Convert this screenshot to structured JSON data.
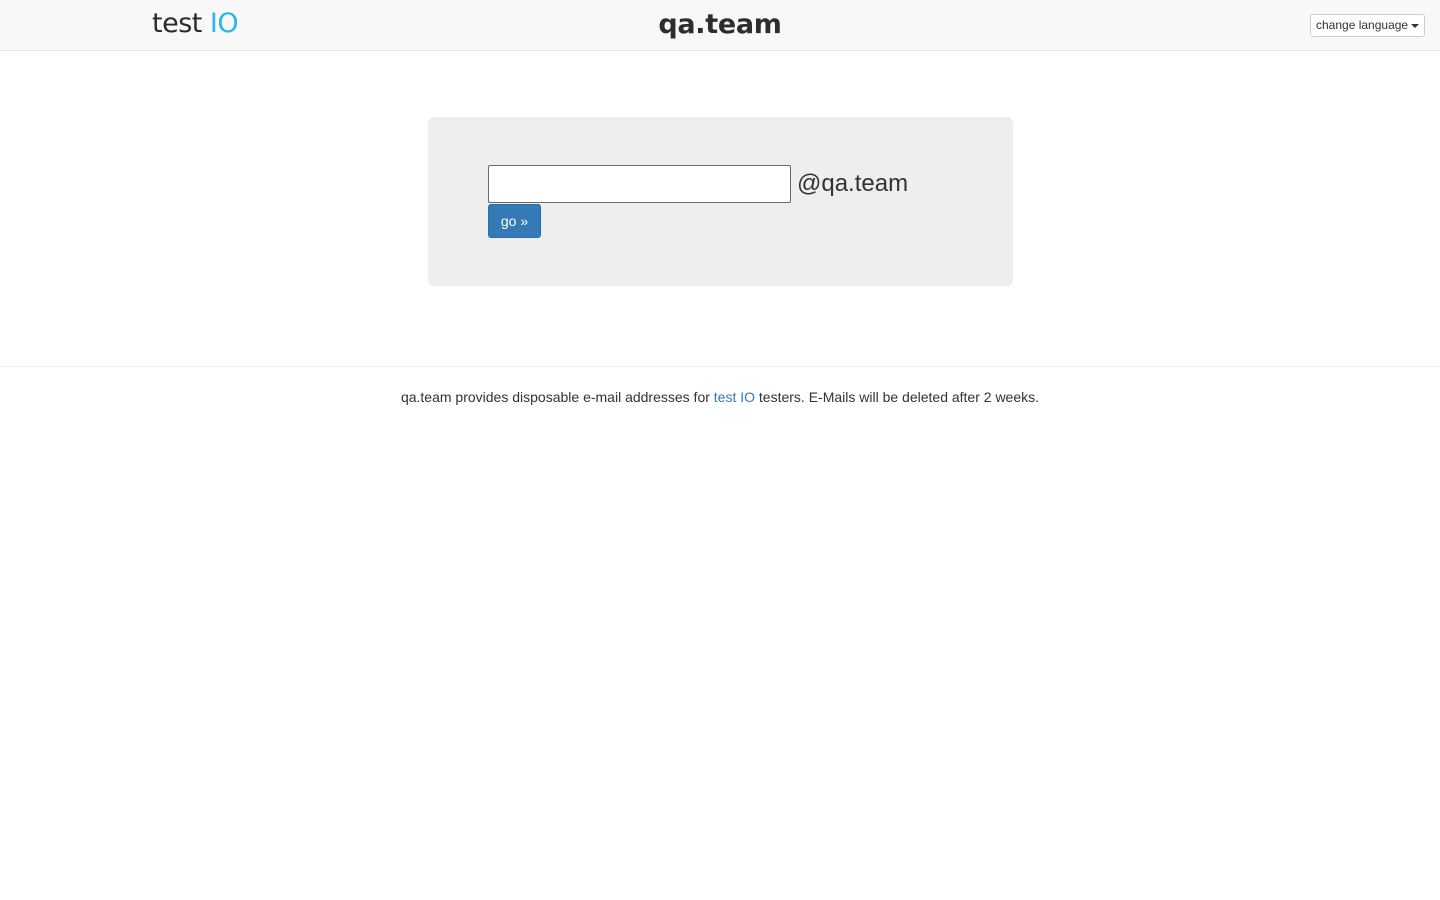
{
  "header": {
    "logo": {
      "word1": "test",
      "word2": "IO",
      "word2_color": "#29b6e8"
    },
    "title": "qa.team",
    "language_button": {
      "label": "change language",
      "icon": "caret-down-icon"
    }
  },
  "main": {
    "email_input": {
      "value": "",
      "placeholder": ""
    },
    "domain_suffix": "@qa.team",
    "go_button_label": "go »",
    "accent_color": "#337ab7"
  },
  "footer": {
    "text_before": "qa.team provides disposable e-mail addresses for",
    "link_text": "test IO",
    "text_after": "testers. E-Mails will be deleted after 2 weeks."
  }
}
